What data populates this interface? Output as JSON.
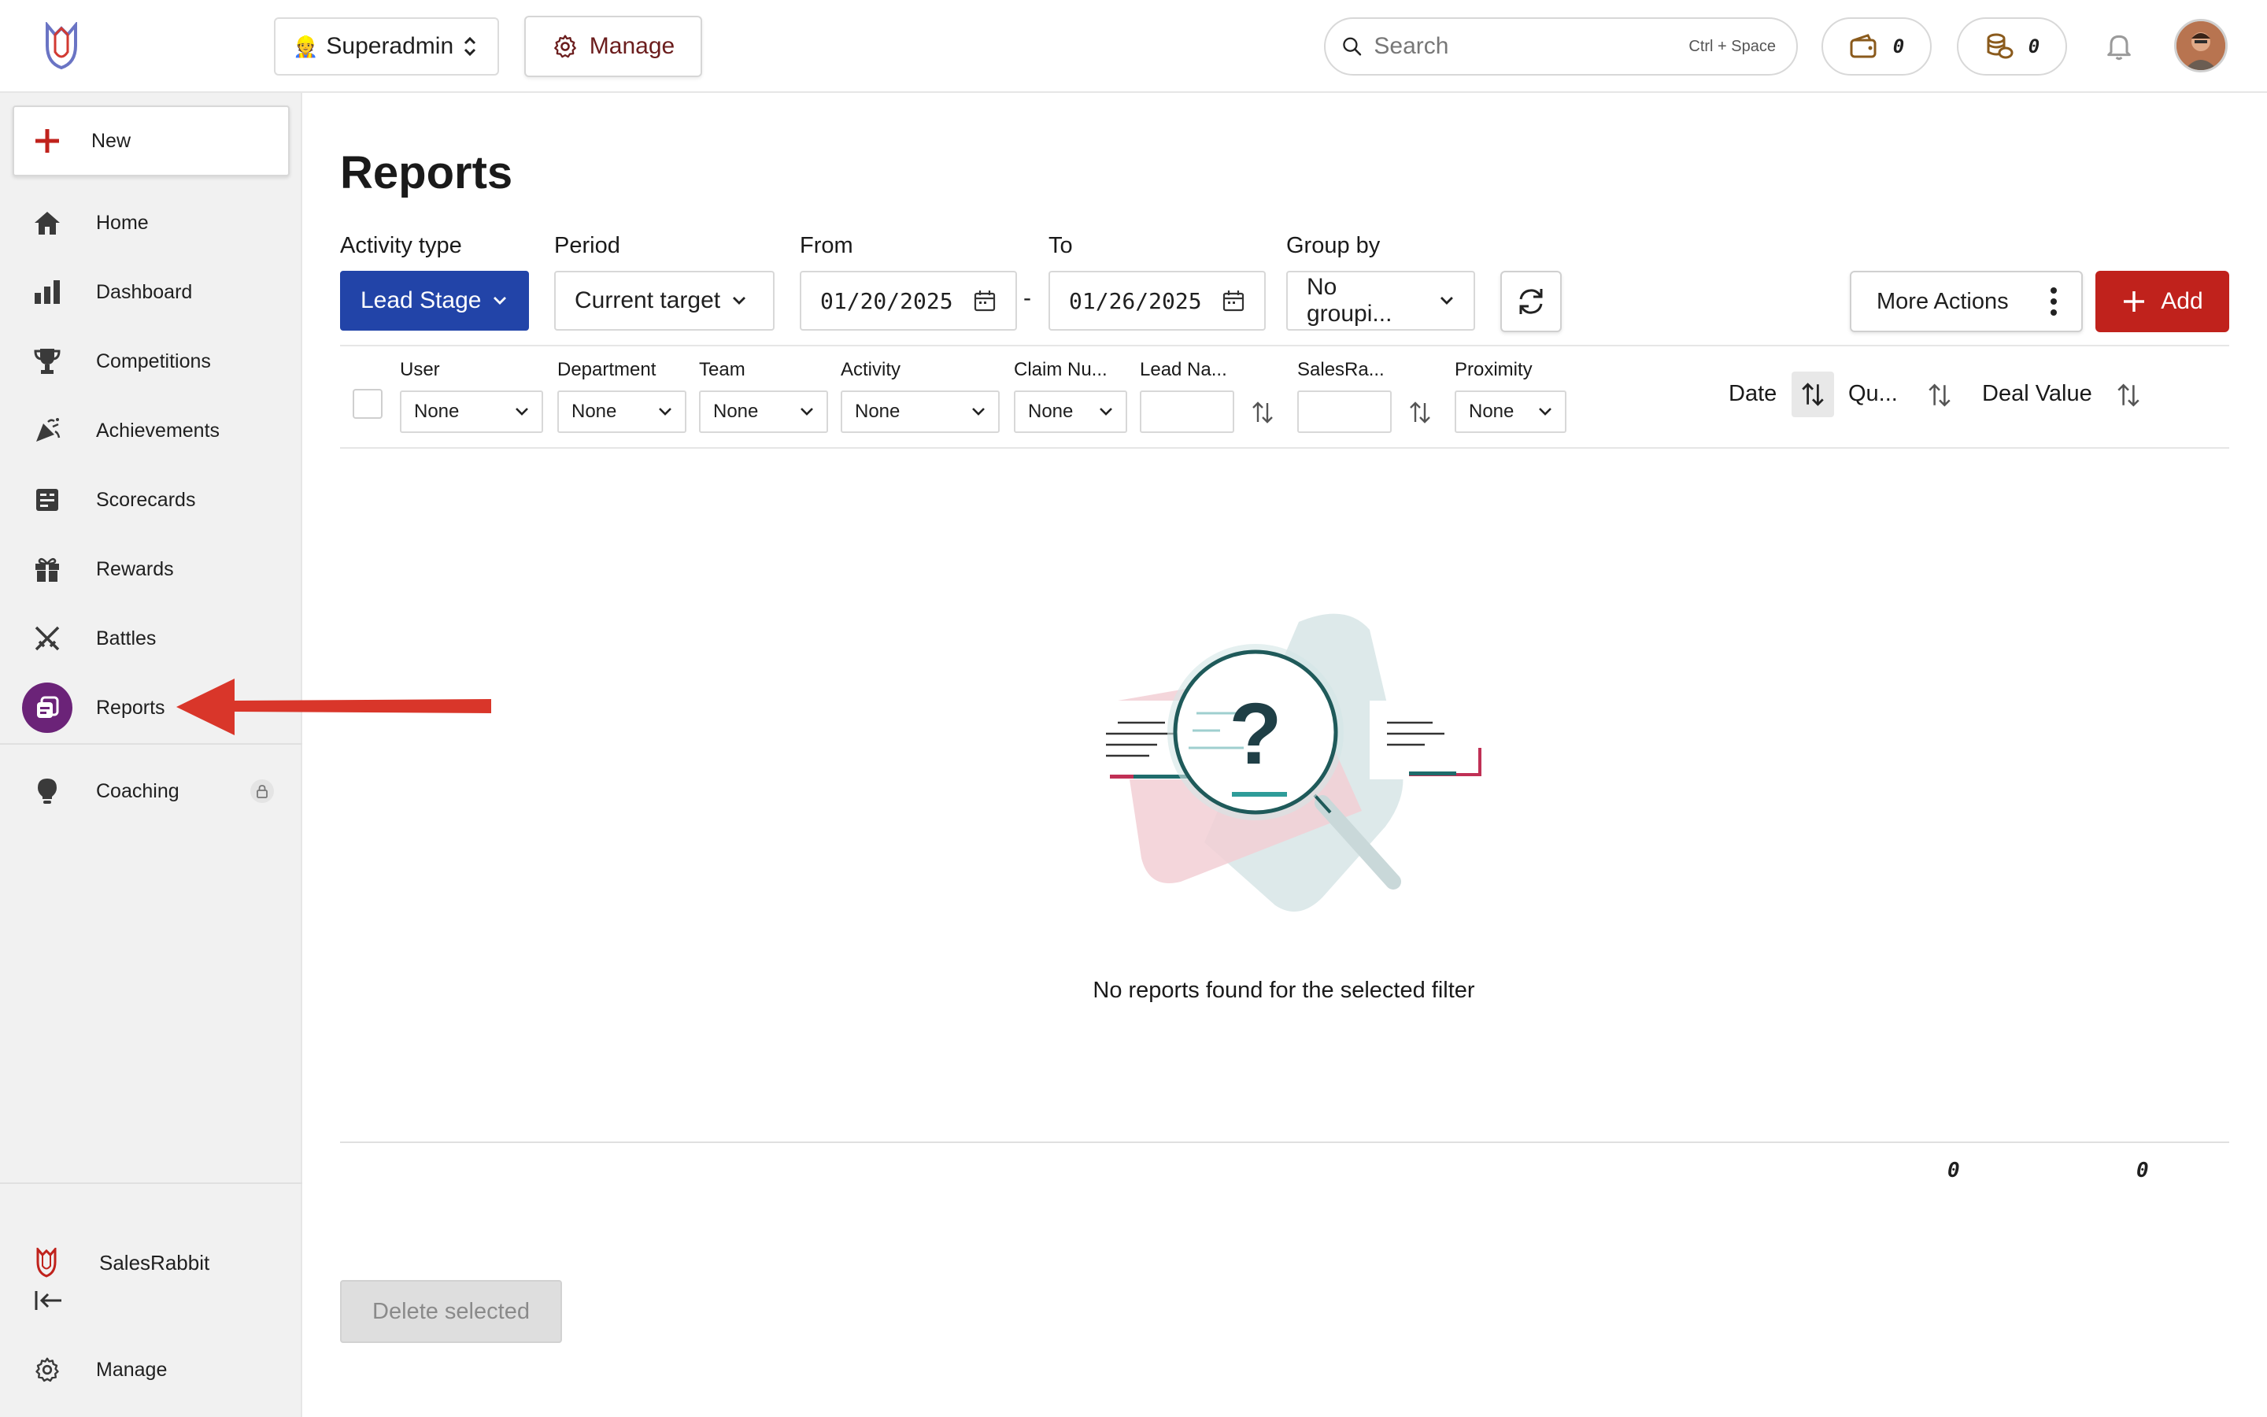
{
  "header": {
    "role_emoji": "👷",
    "role_label": "Superadmin",
    "manage_label": "Manage",
    "search_placeholder": "Search",
    "search_shortcut": "Ctrl + Space",
    "wallet_count": "0",
    "coins_count": "0"
  },
  "sidebar": {
    "new_label": "New",
    "items": [
      {
        "label": "Home"
      },
      {
        "label": "Dashboard"
      },
      {
        "label": "Competitions"
      },
      {
        "label": "Achievements"
      },
      {
        "label": "Scorecards"
      },
      {
        "label": "Rewards"
      },
      {
        "label": "Battles"
      },
      {
        "label": "Reports",
        "active": true
      },
      {
        "label": "Coaching",
        "locked": true
      }
    ],
    "brand_label": "SalesRabbit",
    "manage_label": "Manage"
  },
  "main": {
    "title": "Reports",
    "filters": {
      "activity_type_label": "Activity type",
      "activity_type_value": "Lead Stage",
      "period_label": "Period",
      "period_value": "Current target",
      "from_label": "From",
      "from_value": "01/20/2025",
      "to_label": "To",
      "to_value": "01/26/2025",
      "group_by_label": "Group by",
      "group_by_value": "No groupi...",
      "date_separator": "-"
    },
    "more_actions_label": "More Actions",
    "add_label": "Add",
    "columns": {
      "user": {
        "label": "User",
        "value": "None"
      },
      "department": {
        "label": "Department",
        "value": "None"
      },
      "team": {
        "label": "Team",
        "value": "None"
      },
      "activity": {
        "label": "Activity",
        "value": "None"
      },
      "claim_number": {
        "label": "Claim Nu...",
        "value": "None"
      },
      "lead_name": {
        "label": "Lead Na..."
      },
      "sales_rabbit": {
        "label": "SalesRa..."
      },
      "proximity": {
        "label": "Proximity",
        "value": "None"
      },
      "date": {
        "label": "Date"
      },
      "quantity": {
        "label": "Qu..."
      },
      "deal_value": {
        "label": "Deal Value"
      }
    },
    "empty_message": "No reports found for the selected filter",
    "totals": {
      "quantity": "0",
      "deal_value": "0"
    },
    "delete_selected_label": "Delete selected"
  },
  "colors": {
    "primary_blue": "#2244a8",
    "add_red": "#c0221c",
    "active_nav_purple": "#6b2378",
    "annotation_arrow": "#d9362a"
  }
}
